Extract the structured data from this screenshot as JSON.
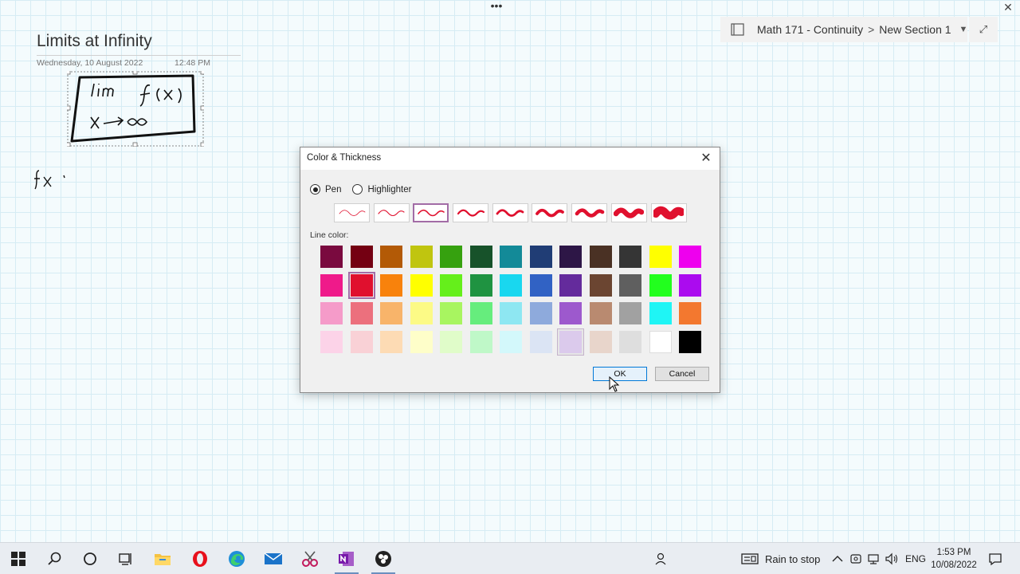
{
  "window": {
    "more_glyph": "•••",
    "close_glyph": "✕"
  },
  "breadcrumb": {
    "notebook": "Math 171 - Continuity",
    "separator": ">",
    "section": "New Section 1",
    "caret": "▼",
    "expand_glyph": "⤢"
  },
  "page": {
    "title": "Limits at Infinity",
    "date": "Wednesday, 10 August 2022",
    "time": "12:48 PM"
  },
  "dialog": {
    "title": "Color & Thickness",
    "close_glyph": "✕",
    "mode_options": [
      {
        "label": "Pen",
        "checked": true
      },
      {
        "label": "Highlighter",
        "checked": false
      }
    ],
    "thickness_selected_index": 2,
    "thickness_count": 9,
    "line_color_label": "Line color:",
    "palette": [
      [
        "#7a0a3f",
        "#740012",
        "#b35a06",
        "#c0c50f",
        "#36a10f",
        "#17522a",
        "#138a98",
        "#203d75",
        "#2d1646",
        "#4a3124",
        "#353535",
        "#ffff00",
        "#ee00ee"
      ],
      [
        "#ef1a8a",
        "#e0102e",
        "#f8820c",
        "#ffff00",
        "#65ef1b",
        "#1f9341",
        "#19d7ef",
        "#3162c4",
        "#642b9c",
        "#6b4531",
        "#5f5f5f",
        "#22ff1e",
        "#ab0bef"
      ],
      [
        "#f59bc9",
        "#ec707d",
        "#f8b46a",
        "#fcfa86",
        "#a8f560",
        "#66ed7d",
        "#8ee7f2",
        "#8eaadc",
        "#9d59cd",
        "#b98a70",
        "#a1a1a1",
        "#1ff5f5",
        "#f3782f"
      ],
      [
        "#fcd3e8",
        "#f9d1d6",
        "#fddbb4",
        "#fefec9",
        "#e0fcc9",
        "#bff8c8",
        "#d3f8fb",
        "#dbe4f4",
        "#dbcaec",
        "#e8d5cb",
        "#dedede",
        "#ffffff",
        "#000000"
      ]
    ],
    "selected_color": "#e0102e",
    "hover_color": "#dbcaec",
    "ok_label": "OK",
    "cancel_label": "Cancel"
  },
  "taskbar": {
    "icons": [
      "windows-start-icon",
      "search-icon",
      "cortana-icon",
      "task-view-icon",
      "file-explorer-icon",
      "opera-icon",
      "edge-icon",
      "mail-icon",
      "snipping-tool-icon",
      "onenote-icon",
      "obs-icon"
    ],
    "weather": "Rain to stop",
    "language": "ENG",
    "time": "1:53 PM",
    "date": "10/08/2022"
  }
}
